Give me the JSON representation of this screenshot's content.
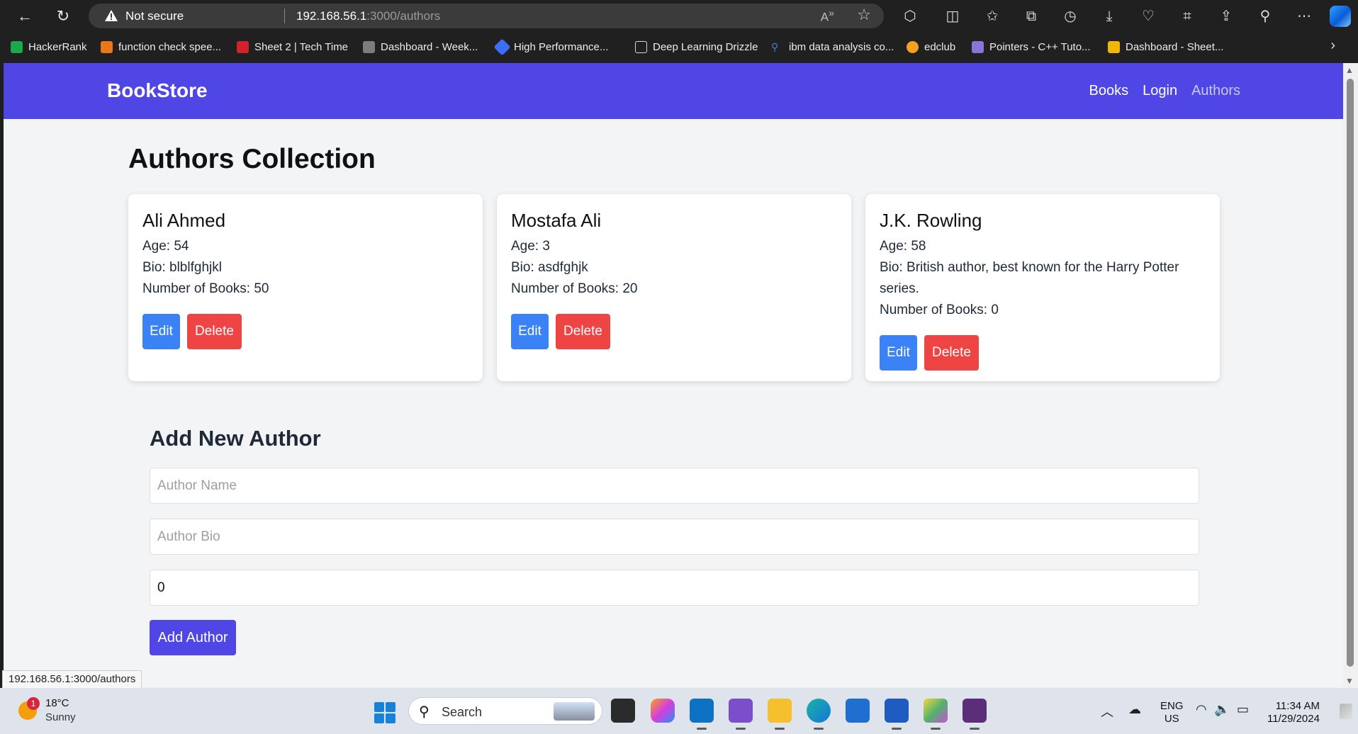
{
  "browser": {
    "security_label": "Not secure",
    "url_host": "192.168.56.1",
    "url_path": ":3000/authors",
    "bookmarks": [
      {
        "label": "HackerRank",
        "color": "#1ba94c"
      },
      {
        "label": "function check spee...",
        "color": "#e8791a"
      },
      {
        "label": "Sheet 2 | Tech Time",
        "color": "#d2232a"
      },
      {
        "label": "Dashboard - Week...",
        "color": "#7d7d7d"
      },
      {
        "label": "High Performance...",
        "color": "#3b6ef5"
      },
      {
        "label": "Deep Learning Drizzle",
        "color": "#d9d9d9"
      },
      {
        "label": "ibm data analysis co...",
        "color": "#4a7bd9"
      },
      {
        "label": "edclub",
        "color": "#f4a21e"
      },
      {
        "label": "Pointers - C++ Tuto...",
        "color": "#8a74d6"
      },
      {
        "label": "Dashboard - Sheet...",
        "color": "#f2b705"
      }
    ]
  },
  "navbar": {
    "brand": "BookStore",
    "links": [
      "Books",
      "Login",
      "Authors"
    ]
  },
  "page": {
    "title": "Authors Collection"
  },
  "authors": [
    {
      "name": "Ali Ahmed",
      "age": "Age: 54",
      "bio": "Bio: blblfghjkl",
      "books": "Number of Books: 50"
    },
    {
      "name": "Mostafa Ali",
      "age": "Age: 3",
      "bio": "Bio: asdfghjk",
      "books": "Number of Books: 20"
    },
    {
      "name": "J.K. Rowling",
      "age": "Age: 58",
      "bio": "Bio: British author, best known for the Harry Potter series.",
      "books": "Number of Books: 0"
    }
  ],
  "card_actions": {
    "edit": "Edit",
    "delete": "Delete"
  },
  "form": {
    "title": "Add New Author",
    "name_placeholder": "Author Name",
    "bio_placeholder": "Author Bio",
    "books_value": "0",
    "submit": "Add Author"
  },
  "status_url": "192.168.56.1:3000/authors",
  "taskbar": {
    "temperature": "18°C",
    "condition": "Sunny",
    "weather_badge": "1",
    "search": "Search",
    "lang_top": "ENG",
    "lang_bottom": "US",
    "time": "11:34 AM",
    "date": "11/29/2024"
  }
}
